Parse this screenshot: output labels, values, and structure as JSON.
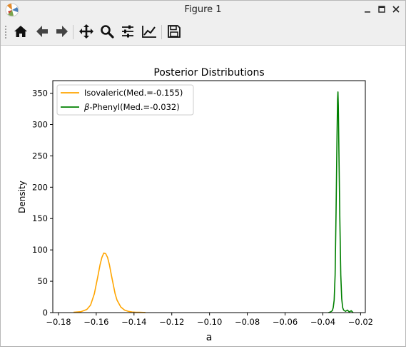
{
  "window": {
    "title": "Figure 1",
    "controls": {
      "minimize": "minimize-icon",
      "maximize": "maximize-icon",
      "close": "close-icon"
    }
  },
  "toolbar": {
    "buttons": [
      {
        "name": "home",
        "icon": "home-icon"
      },
      {
        "name": "back",
        "icon": "arrow-left-icon"
      },
      {
        "name": "forward",
        "icon": "arrow-right-icon"
      },
      {
        "name": "pan",
        "icon": "move-icon"
      },
      {
        "name": "zoom",
        "icon": "magnifier-icon"
      },
      {
        "name": "configure-subplots",
        "icon": "sliders-icon"
      },
      {
        "name": "edit-axis",
        "icon": "line-chart-icon"
      },
      {
        "name": "save",
        "icon": "floppy-disk-icon"
      }
    ]
  },
  "chart_data": {
    "type": "line",
    "title": "Posterior Distributions",
    "xlabel": "a",
    "ylabel": "Density",
    "xlim": [
      -0.183,
      -0.0175
    ],
    "ylim": [
      0,
      370
    ],
    "xticks": [
      -0.18,
      -0.16,
      -0.14,
      -0.12,
      -0.1,
      -0.08,
      -0.06,
      -0.04,
      -0.02
    ],
    "xtick_labels": [
      "−0.18",
      "−0.16",
      "−0.14",
      "−0.12",
      "−0.10",
      "−0.08",
      "−0.06",
      "−0.04",
      "−0.02"
    ],
    "yticks": [
      0,
      50,
      100,
      150,
      200,
      250,
      300,
      350
    ],
    "ytick_labels": [
      "0",
      "50",
      "100",
      "150",
      "200",
      "250",
      "300",
      "350"
    ],
    "grid": false,
    "legend_position": "upper-left",
    "series": [
      {
        "name": "Isovaleric(Med.=-0.155)",
        "color": "#ffa500",
        "x": [
          -0.172,
          -0.168,
          -0.165,
          -0.163,
          -0.161,
          -0.159,
          -0.158,
          -0.157,
          -0.156,
          -0.155,
          -0.154,
          -0.153,
          -0.152,
          -0.151,
          -0.15,
          -0.149,
          -0.147,
          -0.145,
          -0.143,
          -0.141,
          -0.139,
          -0.137,
          -0.135,
          -0.134
        ],
        "values": [
          0.5,
          1.5,
          5,
          12,
          30,
          60,
          76,
          88,
          95,
          94,
          88,
          76,
          60,
          45,
          30,
          20,
          9,
          4,
          2,
          1,
          0.5,
          0.5,
          0.3,
          0.2
        ]
      },
      {
        "name": "β-Phenyl(Med.=-0.032)",
        "legend_math_prefix": "β",
        "legend_suffix": "-Phenyl(Med.=-0.032)",
        "color": "#008000",
        "x": [
          -0.037,
          -0.036,
          -0.035,
          -0.0345,
          -0.034,
          -0.0335,
          -0.033,
          -0.0325,
          -0.0322,
          -0.032,
          -0.0318,
          -0.0315,
          -0.031,
          -0.0305,
          -0.03,
          -0.0295,
          -0.029,
          -0.028,
          -0.027,
          -0.026,
          -0.025,
          -0.024
        ],
        "values": [
          0,
          1,
          3,
          8,
          20,
          60,
          160,
          280,
          340,
          352,
          330,
          260,
          150,
          60,
          22,
          8,
          4,
          2,
          4,
          1,
          3,
          0
        ]
      }
    ]
  }
}
